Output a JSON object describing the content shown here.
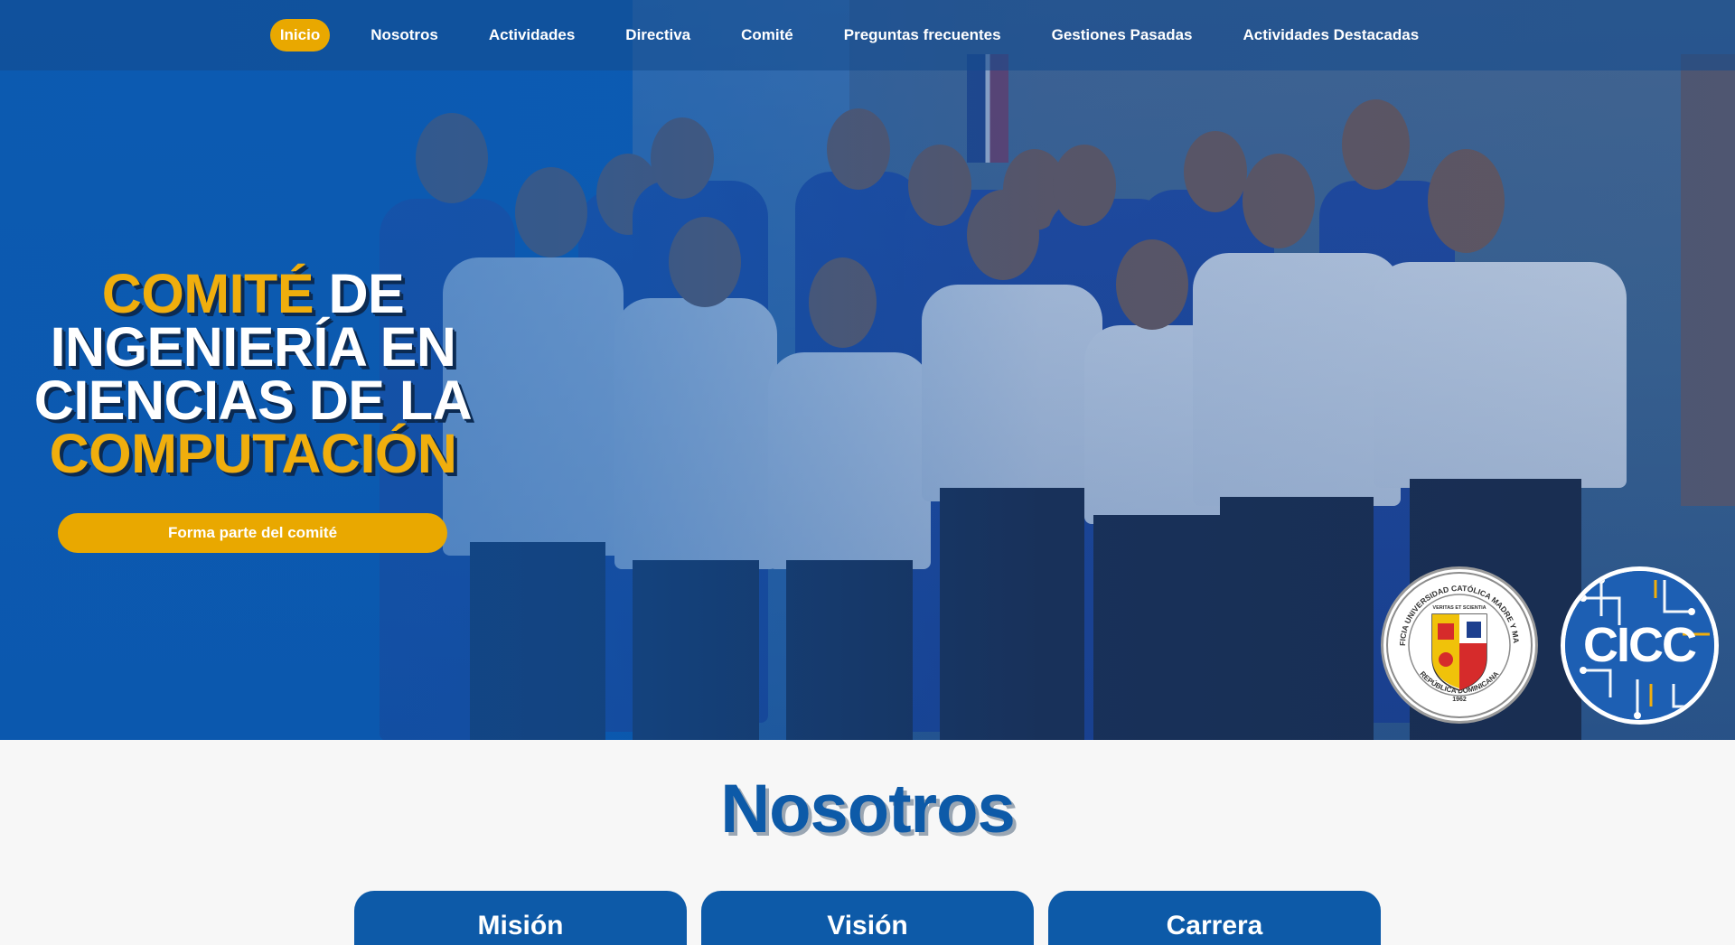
{
  "nav": {
    "items": [
      {
        "label": "Inicio",
        "active": true
      },
      {
        "label": "Nosotros",
        "active": false
      },
      {
        "label": "Actividades",
        "active": false
      },
      {
        "label": "Directiva",
        "active": false
      },
      {
        "label": "Comité",
        "active": false
      },
      {
        "label": "Preguntas frecuentes",
        "active": false
      },
      {
        "label": "Gestiones Pasadas",
        "active": false
      },
      {
        "label": "Actividades Destacadas",
        "active": false
      }
    ]
  },
  "hero": {
    "title_accent_1": "COMITÉ",
    "title_part_1": " DE",
    "title_line_2": "INGENIERÍA EN",
    "title_line_3": "CIENCIAS DE LA",
    "title_accent_2": "COMPUTACIÓN",
    "cta_label": "Forma parte del comité",
    "logos": {
      "seal_name": "university-seal",
      "seal_text_top": "PONTIFICIA UNIVERSIDAD CATÓLICA MADRE Y MAESTRA",
      "seal_text_bottom": "REPÚBLICA DOMINICANA",
      "seal_motto": "VERITAS ET SCIENTIA",
      "seal_year": "1962",
      "cicc_text": "CICC"
    }
  },
  "nosotros": {
    "title": "Nosotros",
    "cards": [
      {
        "label": "Misión"
      },
      {
        "label": "Visión"
      },
      {
        "label": "Carrera"
      }
    ]
  },
  "colors": {
    "brand_blue": "#0d5aa8",
    "accent_yellow": "#e9a800"
  }
}
